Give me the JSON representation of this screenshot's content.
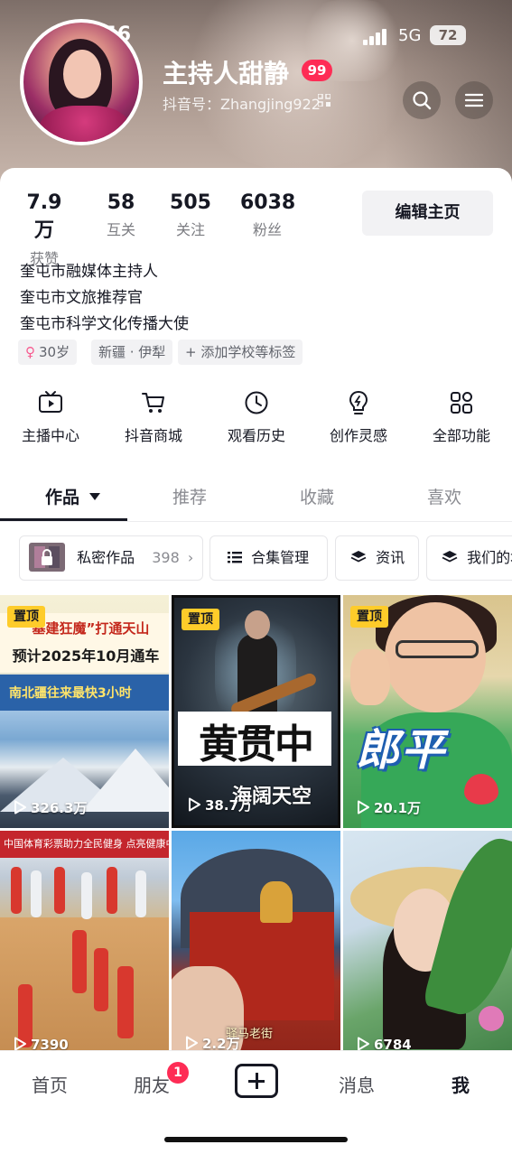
{
  "status_bar": {
    "time": "09:56",
    "network": "5G",
    "battery": "72"
  },
  "profile": {
    "name": "主持人甜静",
    "badge": "99",
    "douyin_id": "抖音号：Zhangjing922"
  },
  "stats": [
    {
      "value": "7.9万",
      "label": "获赞"
    },
    {
      "value": "58",
      "label": "互关"
    },
    {
      "value": "505",
      "label": "关注"
    },
    {
      "value": "6038",
      "label": "粉丝"
    }
  ],
  "edit_profile_label": "编辑主页",
  "bio": [
    "奎屯市融媒体主持人",
    "奎屯市文旅推荐官",
    "奎屯市科学文化传播大使"
  ],
  "tags": {
    "age": "30岁",
    "age_symbol": "♀",
    "location": "新疆 · 伊犁",
    "add_school": "+ 添加学校等标签"
  },
  "functions": [
    {
      "label": "主播中心",
      "icon": "tv-icon"
    },
    {
      "label": "抖音商城",
      "icon": "cart-icon"
    },
    {
      "label": "观看历史",
      "icon": "clock-icon"
    },
    {
      "label": "创作灵感",
      "icon": "bulb-icon"
    },
    {
      "label": "全部功能",
      "icon": "grid-icon"
    }
  ],
  "tabs": [
    "作品",
    "推荐",
    "收藏",
    "喜欢"
  ],
  "chips": {
    "private_works": "私密作品",
    "private_count": "398",
    "collection": "合集管理",
    "news": "资讯",
    "ours": "我们的地"
  },
  "videos": [
    {
      "pinned": "置顶",
      "plays": "326.3万",
      "headline1": "“基建狂魔”打通天山",
      "headline2": "预计2025年10月通车",
      "headline3": "南北疆往来最快3小时"
    },
    {
      "pinned": "置顶",
      "plays": "38.7万",
      "title": "黄贯中",
      "subtitle": "海阔天空"
    },
    {
      "pinned": "置顶",
      "plays": "20.1万",
      "title": "郎平"
    },
    {
      "plays": "7390",
      "banner": "中国体育彩票助力全民健身 点亮健康中国"
    },
    {
      "plays": "2.2万",
      "subtitle": "驿马老街"
    },
    {
      "plays": "6784"
    }
  ],
  "bottom_nav": {
    "home": "首页",
    "friends": "朋友",
    "friends_badge": "1",
    "messages": "消息",
    "me": "我"
  }
}
